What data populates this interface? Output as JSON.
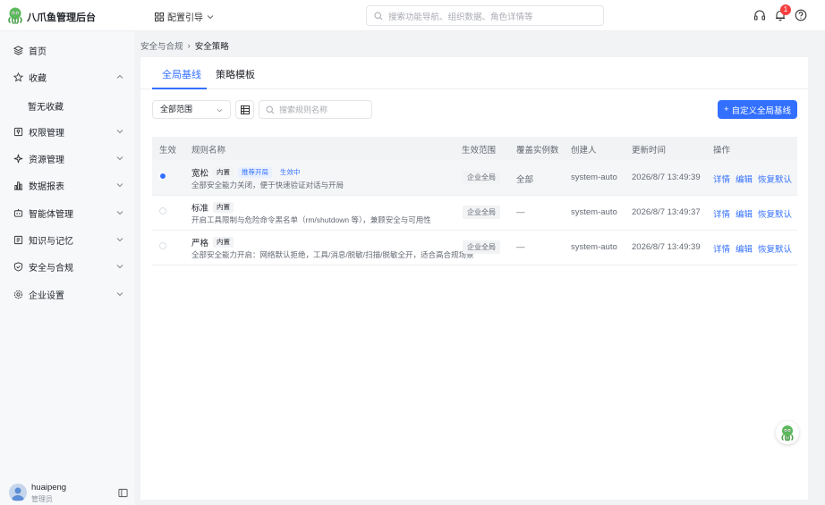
{
  "app": {
    "title": "八爪鱼管理后台"
  },
  "header": {
    "guide_label": "配置引导",
    "search_placeholder": "搜索功能导航、组织数据、角色详情等",
    "notification_count": "1"
  },
  "sidebar": {
    "items": [
      {
        "label": "首页",
        "icon": "layers-icon"
      },
      {
        "label": "收藏",
        "icon": "star-icon",
        "expanded": true
      },
      {
        "label": "权限管理",
        "icon": "key-icon"
      },
      {
        "label": "资源管理",
        "icon": "puzzle-icon"
      },
      {
        "label": "数据报表",
        "icon": "bar-chart-icon"
      },
      {
        "label": "智能体管理",
        "icon": "robot-icon"
      },
      {
        "label": "知识与记忆",
        "icon": "book-icon"
      },
      {
        "label": "安全与合规",
        "icon": "shield-icon"
      },
      {
        "label": "企业设置",
        "icon": "gear-icon"
      }
    ],
    "favorites_empty": "暂无收藏",
    "user": {
      "name": "huaipeng",
      "role": "管理员"
    }
  },
  "breadcrumb": {
    "parent": "安全与合规",
    "separator": "›",
    "current": "安全策略"
  },
  "tabs": [
    {
      "label": "全局基线",
      "active": true
    },
    {
      "label": "策略模板",
      "active": false
    }
  ],
  "toolbar": {
    "scope_value": "全部范围",
    "search_placeholder": "搜索规则名称",
    "add_label": "自定义全局基线"
  },
  "table": {
    "columns": [
      "生效",
      "规则名称",
      "生效范围",
      "覆盖实例数",
      "创建人",
      "更新时间",
      "操作"
    ],
    "rows": [
      {
        "active": true,
        "name": "宽松",
        "tags": [
          "内置",
          "推荐开局",
          "生效中"
        ],
        "desc": "全部安全能力关闭，便于快速验证对话与开局",
        "scope": "企业全局",
        "coverage": "全部",
        "creator": "system-auto",
        "updated": "2026/8/7 13:49:39",
        "ops": [
          "详情",
          "编辑",
          "恢复默认"
        ]
      },
      {
        "active": false,
        "name": "标准",
        "tags": [
          "内置"
        ],
        "desc": "开启工具限制与危险命令黑名单（rm/shutdown 等），兼顾安全与可用性",
        "scope": "企业全局",
        "coverage": "—",
        "creator": "system-auto",
        "updated": "2026/8/7 13:49:37",
        "ops": [
          "详情",
          "编辑",
          "恢复默认"
        ]
      },
      {
        "active": false,
        "name": "严格",
        "tags": [
          "内置"
        ],
        "desc": "全部安全能力开启：网络默认拒绝，工具/消息/脱敏/扫描/脱敏全开，适合高合规场景",
        "scope": "企业全局",
        "coverage": "—",
        "creator": "system-auto",
        "updated": "2026/8/7 13:49:39",
        "ops": [
          "详情",
          "编辑",
          "恢复默认"
        ]
      }
    ]
  },
  "colors": {
    "accent": "#3370ff",
    "badge": "#f53f3f"
  }
}
